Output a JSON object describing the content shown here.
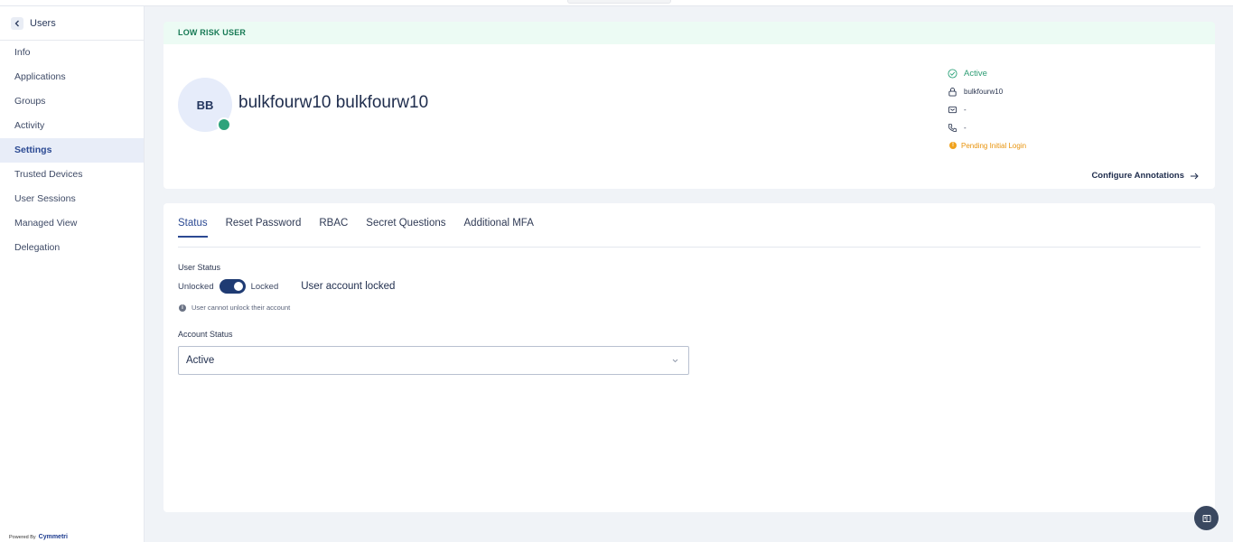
{
  "sidebar": {
    "back_label": "Users",
    "items": [
      {
        "label": "Info",
        "active": false
      },
      {
        "label": "Applications",
        "active": false
      },
      {
        "label": "Groups",
        "active": false
      },
      {
        "label": "Activity",
        "active": false
      },
      {
        "label": "Settings",
        "active": true
      },
      {
        "label": "Trusted Devices",
        "active": false
      },
      {
        "label": "User Sessions",
        "active": false
      },
      {
        "label": "Managed View",
        "active": false
      },
      {
        "label": "Delegation",
        "active": false
      }
    ],
    "powered_by": "Powered By",
    "brand": "Cymmetri"
  },
  "header": {
    "risk_label": "LOW RISK USER",
    "avatar_initials": "BB",
    "user_name": "bulkfourw10 bulkfourw10",
    "status": "Active",
    "username": "bulkfourw10",
    "email": "-",
    "phone": "-",
    "pending": "Pending Initial Login",
    "configure_label": "Configure Annotations"
  },
  "main": {
    "tabs": [
      {
        "label": "Status",
        "active": true
      },
      {
        "label": "Reset Password",
        "active": false
      },
      {
        "label": "RBAC",
        "active": false
      },
      {
        "label": "Secret Questions",
        "active": false
      },
      {
        "label": "Additional MFA",
        "active": false
      }
    ],
    "user_status_label": "User Status",
    "toggle_off_label": "Unlocked",
    "toggle_on_label": "Locked",
    "toggle_state": "Locked",
    "locked_message": "User account locked",
    "info_note": "User cannot unlock their account",
    "account_status_label": "Account Status",
    "account_status_value": "Active"
  },
  "colors": {
    "accent": "#2c4a93",
    "success": "#2ea37b",
    "warning": "#f0a21d",
    "toggle": "#1f3b73"
  }
}
